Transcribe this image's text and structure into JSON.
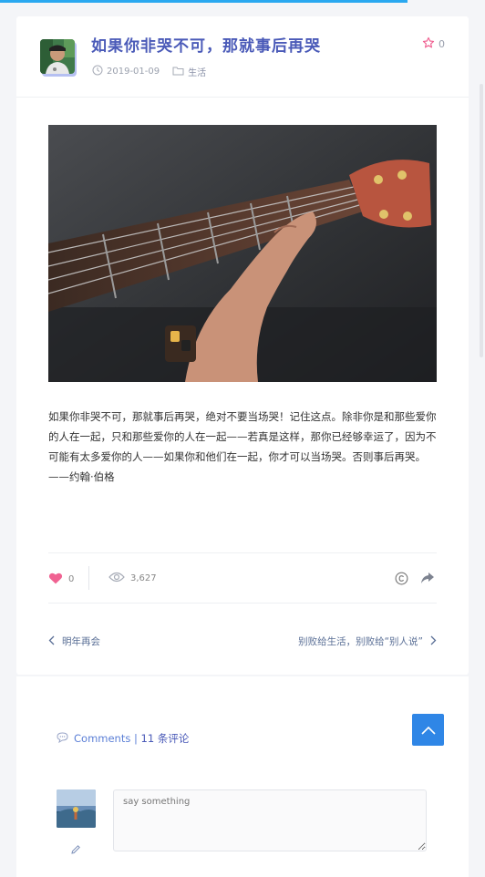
{
  "progress": {
    "value_percent": 84,
    "color": "#2aa8f0"
  },
  "post": {
    "title": "如果你非哭不可，那就事后再哭",
    "date": "2019-01-09",
    "category": "生活",
    "star_count": "0",
    "content": "如果你非哭不可，那就事后再哭，绝对不要当场哭！记住这点。除非你是和那些爱你的人在一起，只和那些爱你的人在一起——若真是这样，那你已经够幸运了，因为不可能有太多爱你的人——如果你和他们在一起，你才可以当场哭。否则事后再哭。——约翰·伯格"
  },
  "actions": {
    "like_count": "0",
    "view_count": "3,627"
  },
  "navigation": {
    "prev_label": "明年再会",
    "next_label": "别败给生活，别败给“别人说”"
  },
  "comments": {
    "label": "Comments |",
    "count_text": "11 条评论",
    "placeholder": "say something"
  },
  "icons": {
    "date": "clock-icon",
    "category": "folder-icon",
    "star": "star-icon",
    "like": "heart-icon",
    "views": "eye-icon",
    "license": "copyright-icon",
    "share": "share-icon",
    "prev": "chevron-left-icon",
    "next": "chevron-right-icon",
    "comments": "chat-icon",
    "back_to_top": "chevron-up-icon",
    "edit": "pencil-icon"
  },
  "colors": {
    "accent": "#4a5ab8",
    "heart": "#f06292",
    "star": "#f06292",
    "back_to_top": "#2f86e6"
  }
}
